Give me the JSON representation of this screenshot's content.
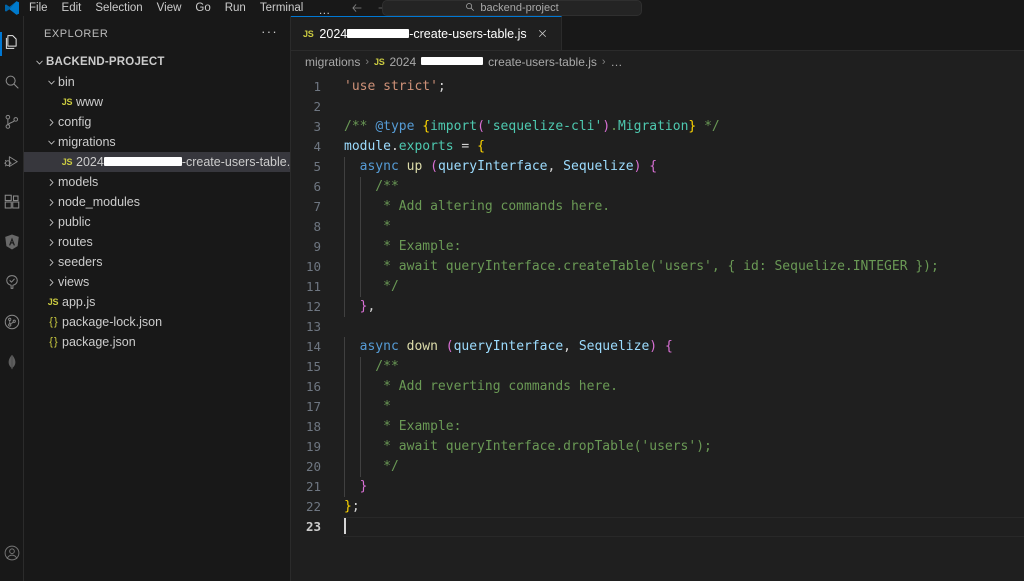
{
  "window": {
    "title": "backend-project",
    "command_center_text": "backend-project",
    "command_center_icon": "search-icon"
  },
  "menu": {
    "items": [
      {
        "label": "File"
      },
      {
        "label": "Edit"
      },
      {
        "label": "Selection"
      },
      {
        "label": "View"
      },
      {
        "label": "Go"
      },
      {
        "label": "Run"
      },
      {
        "label": "Terminal"
      }
    ],
    "overflow_label": "…"
  },
  "navigation": {
    "back_icon": "arrow-left-icon",
    "forward_icon": "arrow-right-icon"
  },
  "activity_bar": {
    "items": [
      {
        "name": "explorer",
        "icon": "files-icon",
        "active": true
      },
      {
        "name": "search",
        "icon": "search-icon",
        "active": false
      },
      {
        "name": "source-control",
        "icon": "source-control-icon",
        "active": false
      },
      {
        "name": "run-and-debug",
        "icon": "run-debug-icon",
        "active": false
      },
      {
        "name": "extensions",
        "icon": "extensions-icon",
        "active": false
      },
      {
        "name": "angular",
        "icon": "angular-icon",
        "active": false
      },
      {
        "name": "testing",
        "icon": "beaker-tree-icon",
        "active": false
      },
      {
        "name": "git-graph",
        "icon": "git-graph-icon",
        "active": false
      },
      {
        "name": "mongodb",
        "icon": "mongodb-leaf-icon",
        "active": false
      }
    ],
    "bottom_items": [
      {
        "name": "accounts",
        "icon": "account-icon"
      }
    ]
  },
  "sidebar": {
    "header": {
      "title": "EXPLORER",
      "actions_label": "···"
    },
    "tree": [
      {
        "label": "BACKEND-PROJECT",
        "type": "root",
        "expanded": true,
        "depth": 0,
        "icon": "chevron-down-icon"
      },
      {
        "label": "bin",
        "type": "folder",
        "expanded": true,
        "depth": 1,
        "icon": "chevron-down-icon"
      },
      {
        "label": "www",
        "type": "file-js",
        "depth": 2,
        "icon": "js-file-icon"
      },
      {
        "label": "config",
        "type": "folder",
        "expanded": false,
        "depth": 1,
        "icon": "chevron-right-icon"
      },
      {
        "label": "migrations",
        "type": "folder",
        "expanded": true,
        "depth": 1,
        "icon": "chevron-down-icon"
      },
      {
        "label_prefix": "2024",
        "redacted": true,
        "label_suffix": "-create-users-table.js",
        "type": "file-js",
        "depth": 2,
        "icon": "js-file-icon",
        "selected": true
      },
      {
        "label": "models",
        "type": "folder",
        "expanded": false,
        "depth": 1,
        "icon": "chevron-right-icon"
      },
      {
        "label": "node_modules",
        "type": "folder",
        "expanded": false,
        "depth": 1,
        "icon": "chevron-right-icon"
      },
      {
        "label": "public",
        "type": "folder",
        "expanded": false,
        "depth": 1,
        "icon": "chevron-right-icon"
      },
      {
        "label": "routes",
        "type": "folder",
        "expanded": false,
        "depth": 1,
        "icon": "chevron-right-icon"
      },
      {
        "label": "seeders",
        "type": "folder",
        "expanded": false,
        "depth": 1,
        "icon": "chevron-right-icon"
      },
      {
        "label": "views",
        "type": "folder",
        "expanded": false,
        "depth": 1,
        "icon": "chevron-right-icon"
      },
      {
        "label": "app.js",
        "type": "file-js",
        "depth": 1,
        "icon": "js-file-icon"
      },
      {
        "label": "package-lock.json",
        "type": "file-json",
        "depth": 1,
        "icon": "json-file-icon"
      },
      {
        "label": "package.json",
        "type": "file-json",
        "depth": 1,
        "icon": "json-file-icon"
      }
    ]
  },
  "editor": {
    "tab": {
      "icon": "js-file-icon",
      "label_prefix": "2024",
      "redacted": true,
      "label_suffix": "-create-users-table.js",
      "close_icon": "close-icon",
      "active": true
    },
    "breadcrumbs": [
      {
        "label": "migrations",
        "icon": null
      },
      {
        "label_prefix": "2024",
        "redacted": true,
        "label_suffix": "create-users-table.js",
        "icon": "js-file-icon"
      },
      {
        "label": "…",
        "icon": null
      }
    ],
    "breadcrumb_separator": "›",
    "cursor_line": 23,
    "code": [
      {
        "n": 1,
        "tokens": [
          {
            "t": "'use strict'",
            "c": "c-string"
          },
          {
            "t": ";",
            "c": "c-plain"
          }
        ]
      },
      {
        "n": 2,
        "tokens": []
      },
      {
        "n": 3,
        "tokens": [
          {
            "t": "/** ",
            "c": "c-comment"
          },
          {
            "t": "@type",
            "c": "c-jsdoc"
          },
          {
            "t": " ",
            "c": "c-comment"
          },
          {
            "t": "{",
            "c": "c-br1"
          },
          {
            "t": "import",
            "c": "c-type"
          },
          {
            "t": "(",
            "c": "c-br2"
          },
          {
            "t": "'sequelize-cli'",
            "c": "c-type"
          },
          {
            "t": ")",
            "c": "c-br2"
          },
          {
            "t": ".",
            "c": "c-comment"
          },
          {
            "t": "Migration",
            "c": "c-type"
          },
          {
            "t": "}",
            "c": "c-br1"
          },
          {
            "t": " */",
            "c": "c-comment"
          }
        ]
      },
      {
        "n": 4,
        "tokens": [
          {
            "t": "module",
            "c": "c-var"
          },
          {
            "t": ".",
            "c": "c-plain"
          },
          {
            "t": "exports",
            "c": "c-type"
          },
          {
            "t": " = ",
            "c": "c-plain"
          },
          {
            "t": "{",
            "c": "c-br1"
          }
        ]
      },
      {
        "n": 5,
        "tokens": [
          {
            "t": "  ",
            "c": "c-plain"
          },
          {
            "t": "async",
            "c": "c-keyword"
          },
          {
            "t": " ",
            "c": "c-plain"
          },
          {
            "t": "up",
            "c": "c-func"
          },
          {
            "t": " ",
            "c": "c-plain"
          },
          {
            "t": "(",
            "c": "c-br2"
          },
          {
            "t": "queryInterface",
            "c": "c-var"
          },
          {
            "t": ", ",
            "c": "c-plain"
          },
          {
            "t": "Sequelize",
            "c": "c-var"
          },
          {
            "t": ")",
            "c": "c-br2"
          },
          {
            "t": " ",
            "c": "c-plain"
          },
          {
            "t": "{",
            "c": "c-br2"
          }
        ]
      },
      {
        "n": 6,
        "tokens": [
          {
            "t": "    /**",
            "c": "c-comment"
          }
        ]
      },
      {
        "n": 7,
        "tokens": [
          {
            "t": "     * Add altering commands here.",
            "c": "c-comment"
          }
        ]
      },
      {
        "n": 8,
        "tokens": [
          {
            "t": "     *",
            "c": "c-comment"
          }
        ]
      },
      {
        "n": 9,
        "tokens": [
          {
            "t": "     * Example:",
            "c": "c-comment"
          }
        ]
      },
      {
        "n": 10,
        "tokens": [
          {
            "t": "     * await queryInterface.createTable('users', { id: Sequelize.INTEGER });",
            "c": "c-comment"
          }
        ]
      },
      {
        "n": 11,
        "tokens": [
          {
            "t": "     */",
            "c": "c-comment"
          }
        ]
      },
      {
        "n": 12,
        "tokens": [
          {
            "t": "  ",
            "c": "c-plain"
          },
          {
            "t": "}",
            "c": "c-br2"
          },
          {
            "t": ",",
            "c": "c-plain"
          }
        ]
      },
      {
        "n": 13,
        "tokens": []
      },
      {
        "n": 14,
        "tokens": [
          {
            "t": "  ",
            "c": "c-plain"
          },
          {
            "t": "async",
            "c": "c-keyword"
          },
          {
            "t": " ",
            "c": "c-plain"
          },
          {
            "t": "down",
            "c": "c-func"
          },
          {
            "t": " ",
            "c": "c-plain"
          },
          {
            "t": "(",
            "c": "c-br2"
          },
          {
            "t": "queryInterface",
            "c": "c-var"
          },
          {
            "t": ", ",
            "c": "c-plain"
          },
          {
            "t": "Sequelize",
            "c": "c-var"
          },
          {
            "t": ")",
            "c": "c-br2"
          },
          {
            "t": " ",
            "c": "c-plain"
          },
          {
            "t": "{",
            "c": "c-br2"
          }
        ]
      },
      {
        "n": 15,
        "tokens": [
          {
            "t": "    /**",
            "c": "c-comment"
          }
        ]
      },
      {
        "n": 16,
        "tokens": [
          {
            "t": "     * Add reverting commands here.",
            "c": "c-comment"
          }
        ]
      },
      {
        "n": 17,
        "tokens": [
          {
            "t": "     *",
            "c": "c-comment"
          }
        ]
      },
      {
        "n": 18,
        "tokens": [
          {
            "t": "     * Example:",
            "c": "c-comment"
          }
        ]
      },
      {
        "n": 19,
        "tokens": [
          {
            "t": "     * await queryInterface.dropTable('users');",
            "c": "c-comment"
          }
        ]
      },
      {
        "n": 20,
        "tokens": [
          {
            "t": "     */",
            "c": "c-comment"
          }
        ]
      },
      {
        "n": 21,
        "tokens": [
          {
            "t": "  ",
            "c": "c-plain"
          },
          {
            "t": "}",
            "c": "c-br2"
          }
        ]
      },
      {
        "n": 22,
        "tokens": [
          {
            "t": "}",
            "c": "c-br1"
          },
          {
            "t": ";",
            "c": "c-plain"
          }
        ]
      },
      {
        "n": 23,
        "tokens": [],
        "current": true
      }
    ]
  },
  "colors": {
    "accent": "#0078d4",
    "editor_bg": "#1f1f1f",
    "sidebar_bg": "#181818",
    "selection_bg": "#37373d",
    "comment": "#6a9955",
    "string": "#ce9178",
    "keyword": "#569cd6",
    "type": "#4ec9b0",
    "function": "#dcdcaa",
    "variable": "#9cdcfe",
    "bracket_yellow": "#ffd700",
    "bracket_magenta": "#da70d6",
    "js_icon": "#cbcb41"
  }
}
